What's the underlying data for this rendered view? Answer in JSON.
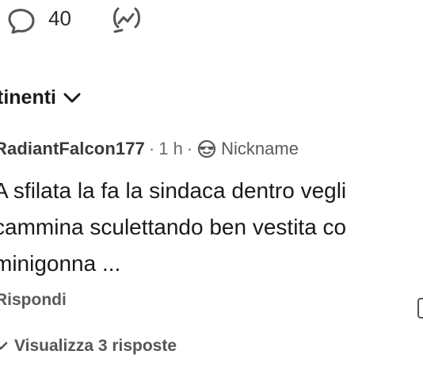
{
  "post_actions": {
    "comment_icon": "comment-bubble-icon",
    "comment_count": "40",
    "insights_icon": "insights-trend-icon"
  },
  "sort": {
    "label": "tinenti",
    "chevron_icon": "chevron-down-icon"
  },
  "comment": {
    "author": "RadiantFalcon177",
    "separator1": "·",
    "time": "1 h",
    "separator2": "·",
    "flair_icon": "sunglasses-face-icon",
    "flair": "Nickname",
    "body_lines": [
      "A sfilata la fa la sindaca dentro vegli",
      "cammina sculettando ben vestita co",
      "minigonna ..."
    ],
    "reply_label": "Rispondi",
    "view_replies_label": "Visualizza 3 risposte"
  },
  "colors": {
    "text_primary": "#1a1a1a",
    "text_secondary": "#5a5a5a",
    "icon": "#555555",
    "background": "#ffffff"
  }
}
